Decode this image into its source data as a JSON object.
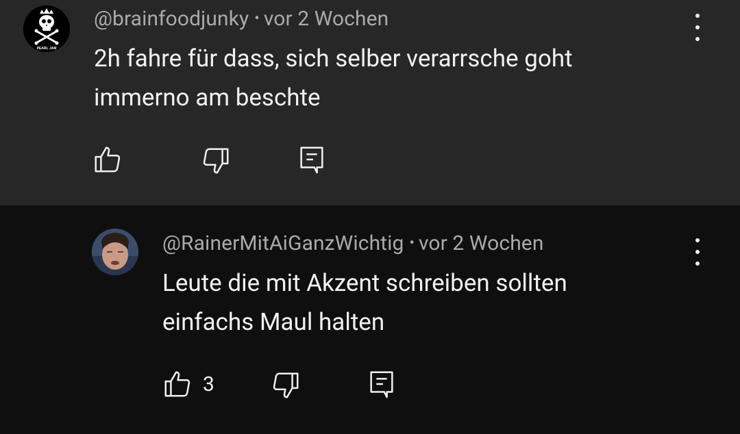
{
  "comments": [
    {
      "handle": "@brainfoodjunky",
      "separator": "•",
      "time": "vor 2 Wochen",
      "text_line1": "2h fahre für dass, sich selber verarrsche goht",
      "text_line2": "immerno am beschte",
      "like_count": "",
      "avatar_caption": "PEARL JAM",
      "avatar_icon": "skull-crossbones-icon"
    },
    {
      "handle": "@RainerMitAiGanzWichtig",
      "separator": "•",
      "time": "vor 2 Wochen",
      "text_line1": "Leute die mit Akzent schreiben sollten",
      "text_line2": "einfachs Maul halten",
      "like_count": "3",
      "avatar_icon": "user-photo-avatar"
    }
  ],
  "icons": {
    "like": "thumbs-up-icon",
    "dislike": "thumbs-down-icon",
    "reply": "reply-comment-icon",
    "more": "more-vertical-icon"
  },
  "colors": {
    "top_background": "#272727",
    "reply_background": "#0f0f0f",
    "primary_text": "#f1f1f1",
    "secondary_text": "#aaaaaa"
  }
}
